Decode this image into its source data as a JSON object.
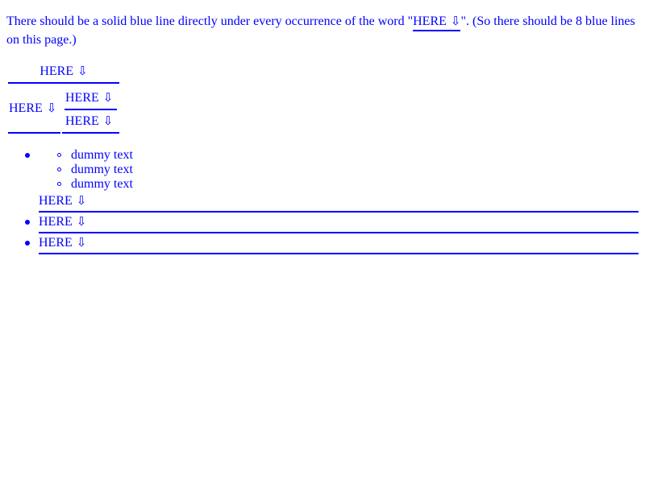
{
  "intro": {
    "before": "There should be a solid blue line directly under every occurrence of the word \"",
    "word": "HERE",
    "arrow": "⇩",
    "after": "\". (So there should be 8 blue lines on this page.)"
  },
  "table": {
    "top_cell": {
      "word": "HERE",
      "arrow": "⇩"
    },
    "left_cell": {
      "word": "HERE",
      "arrow": "⇩"
    },
    "right_top": {
      "word": "HERE",
      "arrow": "⇩"
    },
    "right_bottom": {
      "word": "HERE",
      "arrow": "⇩"
    }
  },
  "list": {
    "sub_items": [
      "dummy text",
      "dummy text",
      "dummy text"
    ],
    "items": [
      {
        "word": "HERE",
        "arrow": "⇩"
      },
      {
        "word": "HERE",
        "arrow": "⇩"
      },
      {
        "word": "HERE",
        "arrow": "⇩"
      }
    ]
  },
  "colors": {
    "text": "#0000ff",
    "line": "#0000ff"
  }
}
